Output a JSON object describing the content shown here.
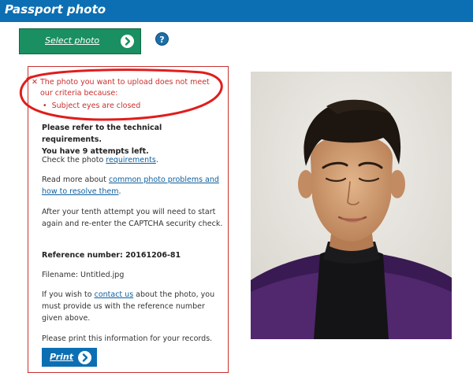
{
  "header": {
    "title": "Passport photo"
  },
  "select_button": {
    "label": "Select photo"
  },
  "help": {
    "label": "?"
  },
  "error": {
    "icon": "✕",
    "message": "The photo you want to upload does not meet our criteria because:",
    "reasons": [
      "Subject eyes are closed"
    ]
  },
  "info": {
    "refer": "Please refer to the technical requirements.",
    "attempts": "You have 9 attempts left.",
    "check_prefix": "Check the photo ",
    "check_link": "requirements",
    "check_suffix": ".",
    "readmore_prefix": "Read more about ",
    "readmore_link": "common photo problems and how to resolve them",
    "readmore_suffix": ".",
    "tenth": "After your tenth attempt you will need to start again and re-enter the CAPTCHA security check.",
    "reference": "Reference number: 20161206-81",
    "filename": "Filename: Untitled.jpg",
    "contact_prefix": "If you wish to ",
    "contact_link": "contact us",
    "contact_suffix": " about the photo, you must provide us with the reference number given above.",
    "print_note": "Please print this information for your records."
  },
  "print_button": {
    "label": "Print"
  },
  "colors": {
    "header": "#0c6fb3",
    "select_button": "#1a8f61",
    "error": "#c8302e",
    "link": "#0c5f9e"
  },
  "icons": {
    "select": "chevron-right-icon",
    "help": "question-icon",
    "error": "close-icon",
    "print": "chevron-right-icon"
  }
}
